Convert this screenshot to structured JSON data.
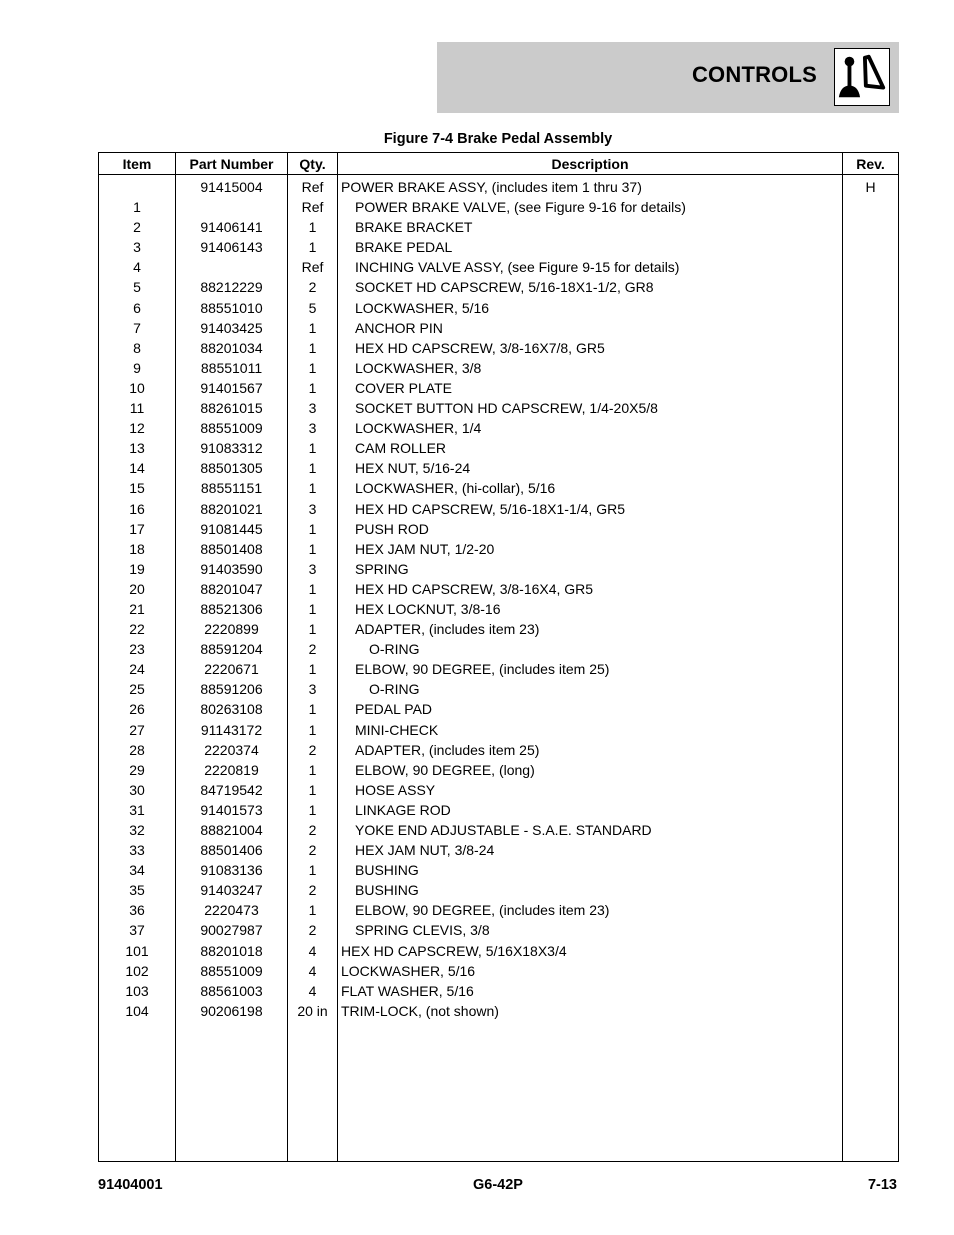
{
  "header": {
    "section_title": "CONTROLS",
    "section_icon": "controls-joystick-pedal-icon"
  },
  "figure_title": "Figure 7-4 Brake Pedal Assembly",
  "table": {
    "columns": [
      "Item",
      "Part Number",
      "Qty.",
      "Description",
      "Rev."
    ],
    "rows": [
      {
        "item": "",
        "part": "91415004",
        "qty": "Ref",
        "desc": "POWER BRAKE ASSY, (includes item 1 thru 37)",
        "indent": 0,
        "rev": "H"
      },
      {
        "item": "1",
        "part": "",
        "qty": "Ref",
        "desc": "POWER BRAKE VALVE, (see Figure 9-16 for details)",
        "indent": 1,
        "rev": ""
      },
      {
        "item": "2",
        "part": "91406141",
        "qty": "1",
        "desc": "BRAKE BRACKET",
        "indent": 1,
        "rev": ""
      },
      {
        "item": "3",
        "part": "91406143",
        "qty": "1",
        "desc": "BRAKE PEDAL",
        "indent": 1,
        "rev": ""
      },
      {
        "item": "4",
        "part": "",
        "qty": "Ref",
        "desc": "INCHING VALVE ASSY, (see Figure 9-15 for details)",
        "indent": 1,
        "rev": ""
      },
      {
        "item": "5",
        "part": "88212229",
        "qty": "2",
        "desc": "SOCKET HD CAPSCREW, 5/16-18X1-1/2, GR8",
        "indent": 1,
        "rev": ""
      },
      {
        "item": "6",
        "part": "88551010",
        "qty": "5",
        "desc": "LOCKWASHER, 5/16",
        "indent": 1,
        "rev": ""
      },
      {
        "item": "7",
        "part": "91403425",
        "qty": "1",
        "desc": "ANCHOR PIN",
        "indent": 1,
        "rev": ""
      },
      {
        "item": "8",
        "part": "88201034",
        "qty": "1",
        "desc": "HEX HD CAPSCREW, 3/8-16X7/8, GR5",
        "indent": 1,
        "rev": ""
      },
      {
        "item": "9",
        "part": "88551011",
        "qty": "1",
        "desc": "LOCKWASHER, 3/8",
        "indent": 1,
        "rev": ""
      },
      {
        "item": "10",
        "part": "91401567",
        "qty": "1",
        "desc": "COVER PLATE",
        "indent": 1,
        "rev": ""
      },
      {
        "item": "11",
        "part": "88261015",
        "qty": "3",
        "desc": "SOCKET BUTTON HD CAPSCREW, 1/4-20X5/8",
        "indent": 1,
        "rev": ""
      },
      {
        "item": "12",
        "part": "88551009",
        "qty": "3",
        "desc": "LOCKWASHER, 1/4",
        "indent": 1,
        "rev": ""
      },
      {
        "item": "13",
        "part": "91083312",
        "qty": "1",
        "desc": "CAM ROLLER",
        "indent": 1,
        "rev": ""
      },
      {
        "item": "14",
        "part": "88501305",
        "qty": "1",
        "desc": "HEX NUT, 5/16-24",
        "indent": 1,
        "rev": ""
      },
      {
        "item": "15",
        "part": "88551151",
        "qty": "1",
        "desc": "LOCKWASHER, (hi-collar), 5/16",
        "indent": 1,
        "rev": ""
      },
      {
        "item": "16",
        "part": "88201021",
        "qty": "3",
        "desc": "HEX HD CAPSCREW, 5/16-18X1-1/4, GR5",
        "indent": 1,
        "rev": ""
      },
      {
        "item": "17",
        "part": "91081445",
        "qty": "1",
        "desc": "PUSH ROD",
        "indent": 1,
        "rev": ""
      },
      {
        "item": "18",
        "part": "88501408",
        "qty": "1",
        "desc": "HEX JAM NUT, 1/2-20",
        "indent": 1,
        "rev": ""
      },
      {
        "item": "19",
        "part": "91403590",
        "qty": "3",
        "desc": "SPRING",
        "indent": 1,
        "rev": ""
      },
      {
        "item": "20",
        "part": "88201047",
        "qty": "1",
        "desc": "HEX HD CAPSCREW, 3/8-16X4, GR5",
        "indent": 1,
        "rev": ""
      },
      {
        "item": "21",
        "part": "88521306",
        "qty": "1",
        "desc": "HEX LOCKNUT, 3/8-16",
        "indent": 1,
        "rev": ""
      },
      {
        "item": "22",
        "part": "2220899",
        "qty": "1",
        "desc": "ADAPTER, (includes item 23)",
        "indent": 1,
        "rev": ""
      },
      {
        "item": "23",
        "part": "88591204",
        "qty": "2",
        "desc": "O-RING",
        "indent": 2,
        "rev": ""
      },
      {
        "item": "24",
        "part": "2220671",
        "qty": "1",
        "desc": "ELBOW, 90 DEGREE, (includes item 25)",
        "indent": 1,
        "rev": ""
      },
      {
        "item": "25",
        "part": "88591206",
        "qty": "3",
        "desc": "O-RING",
        "indent": 2,
        "rev": ""
      },
      {
        "item": "26",
        "part": "80263108",
        "qty": "1",
        "desc": "PEDAL PAD",
        "indent": 1,
        "rev": ""
      },
      {
        "item": "27",
        "part": "91143172",
        "qty": "1",
        "desc": "MINI-CHECK",
        "indent": 1,
        "rev": ""
      },
      {
        "item": "28",
        "part": "2220374",
        "qty": "2",
        "desc": "ADAPTER, (includes item 25)",
        "indent": 1,
        "rev": ""
      },
      {
        "item": "29",
        "part": "2220819",
        "qty": "1",
        "desc": "ELBOW, 90 DEGREE, (long)",
        "indent": 1,
        "rev": ""
      },
      {
        "item": "30",
        "part": "84719542",
        "qty": "1",
        "desc": "HOSE ASSY",
        "indent": 1,
        "rev": ""
      },
      {
        "item": "31",
        "part": "91401573",
        "qty": "1",
        "desc": "LINKAGE ROD",
        "indent": 1,
        "rev": ""
      },
      {
        "item": "32",
        "part": "88821004",
        "qty": "2",
        "desc": "YOKE END ADJUSTABLE - S.A.E. STANDARD",
        "indent": 1,
        "rev": ""
      },
      {
        "item": "33",
        "part": "88501406",
        "qty": "2",
        "desc": "HEX JAM NUT, 3/8-24",
        "indent": 1,
        "rev": ""
      },
      {
        "item": "34",
        "part": "91083136",
        "qty": "1",
        "desc": "BUSHING",
        "indent": 1,
        "rev": ""
      },
      {
        "item": "35",
        "part": "91403247",
        "qty": "2",
        "desc": "BUSHING",
        "indent": 1,
        "rev": ""
      },
      {
        "item": "36",
        "part": "2220473",
        "qty": "1",
        "desc": "ELBOW, 90 DEGREE, (includes item 23)",
        "indent": 1,
        "rev": ""
      },
      {
        "item": "37",
        "part": "90027987",
        "qty": "2",
        "desc": "SPRING CLEVIS, 3/8",
        "indent": 1,
        "rev": ""
      },
      {
        "item": "101",
        "part": "88201018",
        "qty": "4",
        "desc": "HEX HD CAPSCREW, 5/16X18X3/4",
        "indent": 0,
        "rev": ""
      },
      {
        "item": "102",
        "part": "88551009",
        "qty": "4",
        "desc": "LOCKWASHER, 5/16",
        "indent": 0,
        "rev": ""
      },
      {
        "item": "103",
        "part": "88561003",
        "qty": "4",
        "desc": "FLAT WASHER, 5/16",
        "indent": 0,
        "rev": ""
      },
      {
        "item": "104",
        "part": "90206198",
        "qty": "20 in",
        "desc": "TRIM-LOCK, (not shown)",
        "indent": 0,
        "rev": ""
      }
    ]
  },
  "footer": {
    "doc_number": "91404001",
    "model": "G6-42P",
    "page": "7-13"
  }
}
